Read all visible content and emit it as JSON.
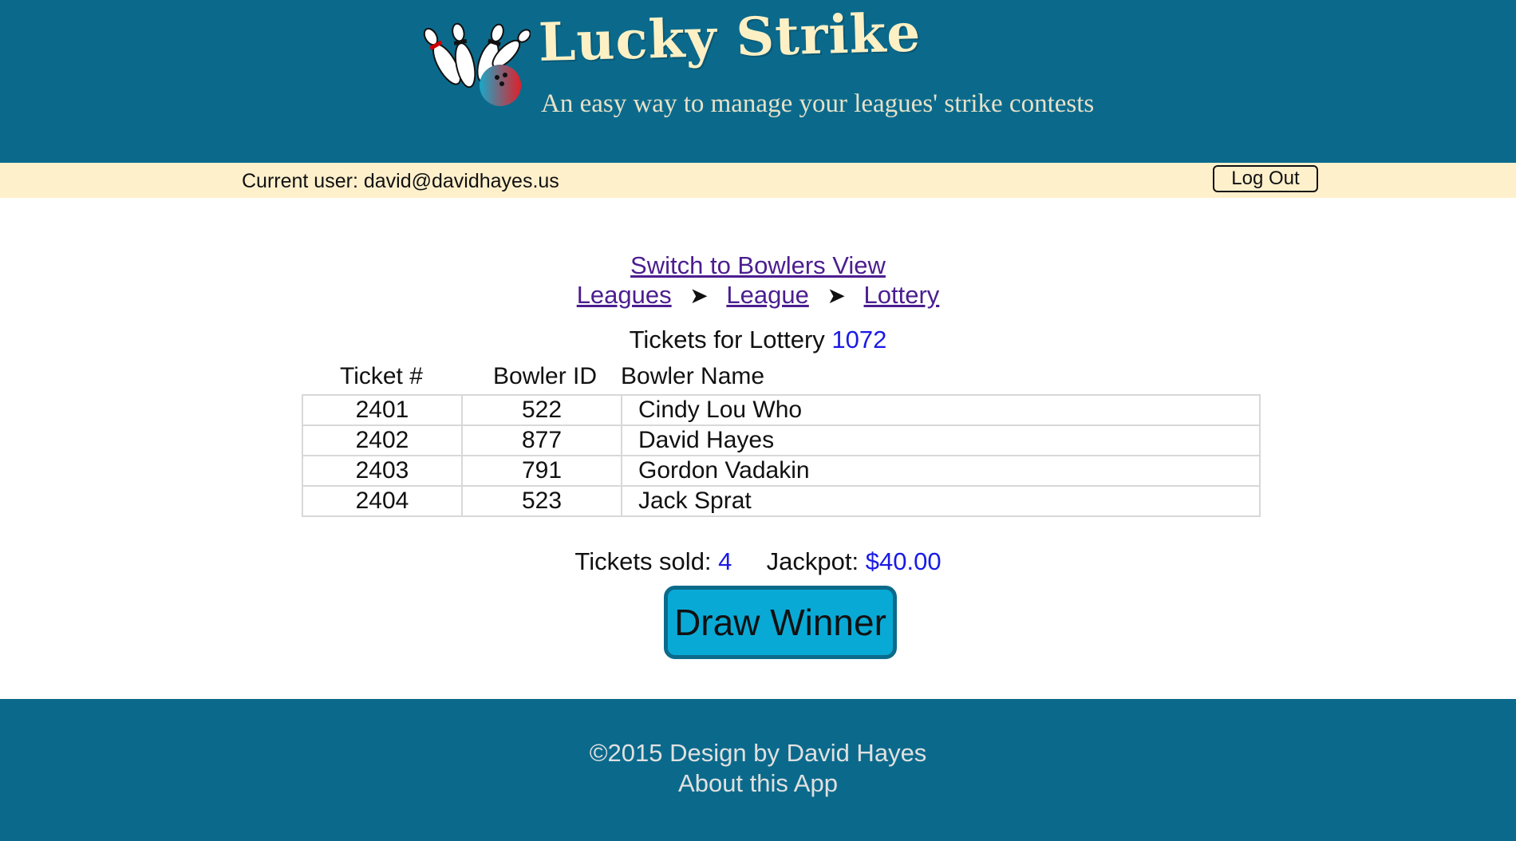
{
  "header": {
    "title": "Lucky Strike",
    "tagline": "An easy way to manage your leagues' strike contests"
  },
  "userbar": {
    "current_user": "Current user: david@davidhayes.us",
    "logout_label": "Log Out"
  },
  "nav": {
    "switch_view": "Switch to Bowlers View",
    "breadcrumbs": [
      "Leagues",
      "League",
      "Lottery"
    ],
    "separator": "➤"
  },
  "main": {
    "heading_prefix": "Tickets for Lottery",
    "lottery_number": "1072",
    "columns": [
      "Ticket #",
      "Bowler ID",
      "Bowler Name"
    ],
    "rows": [
      {
        "ticket": "2401",
        "bowler_id": "522",
        "bowler_name": "Cindy Lou Who"
      },
      {
        "ticket": "2402",
        "bowler_id": "877",
        "bowler_name": "David Hayes"
      },
      {
        "ticket": "2403",
        "bowler_id": "791",
        "bowler_name": "Gordon Vadakin"
      },
      {
        "ticket": "2404",
        "bowler_id": "523",
        "bowler_name": "Jack Sprat"
      }
    ],
    "tickets_sold_label": "Tickets sold:",
    "tickets_sold": "4",
    "jackpot_label": "Jackpot:",
    "jackpot": "$40.00",
    "draw_label": "Draw Winner"
  },
  "footer": {
    "copyright": "©2015 Design by David Hayes",
    "about": "About this App"
  },
  "colors": {
    "brand_teal": "#0b6a8c",
    "userbar_cream": "#fff0cc",
    "draw_button": "#09a9d6",
    "link_purple": "#4b1e8f",
    "number_blue": "#1a1ae6"
  },
  "icons": {
    "logo": "bowling-pins-and-ball-logo"
  }
}
